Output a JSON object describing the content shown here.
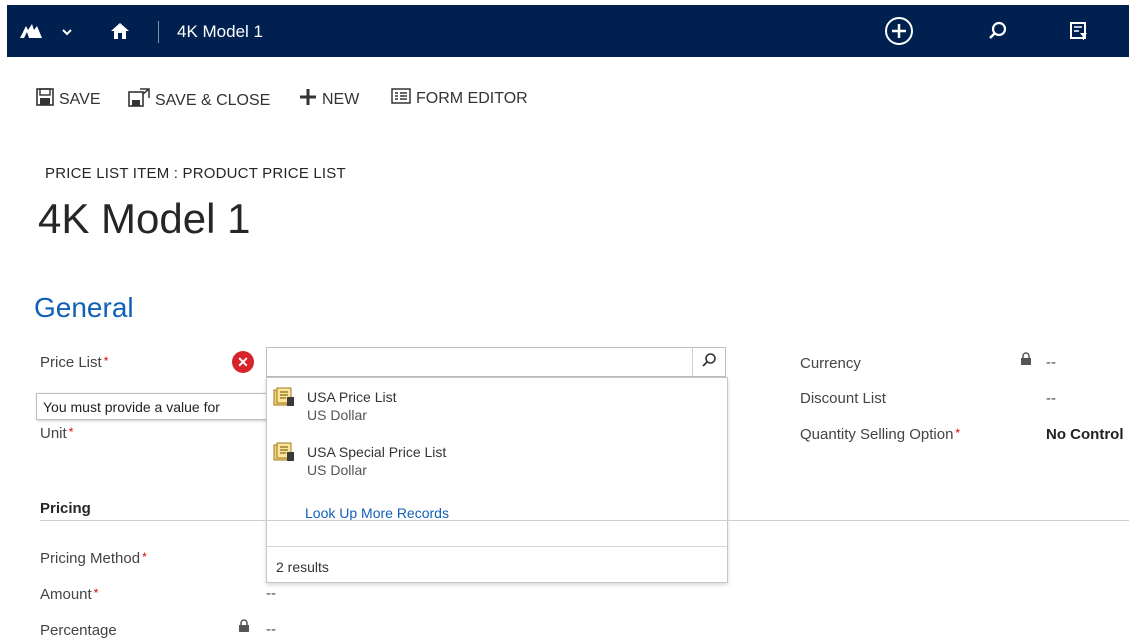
{
  "header": {
    "title": "4K Model 1"
  },
  "toolbar": {
    "save_label": "SAVE",
    "save_close_label": "SAVE & CLOSE",
    "new_label": "NEW",
    "form_editor_label": "FORM EDITOR"
  },
  "record": {
    "breadcrumb": "PRICE LIST ITEM : PRODUCT PRICE LIST",
    "title": "4K Model 1"
  },
  "section": {
    "general_label": "General",
    "pricing_label": "Pricing"
  },
  "fields": {
    "price_list_label": "Price List",
    "unit_label": "Unit",
    "error_tooltip": "You must provide a value for",
    "currency_label": "Currency",
    "currency_value": "--",
    "discount_list_label": "Discount List",
    "discount_list_value": "--",
    "quantity_selling_label": "Quantity Selling Option",
    "quantity_selling_value": "No Control",
    "pricing_method_label": "Pricing Method",
    "amount_label": "Amount",
    "amount_value": "--",
    "percentage_label": "Percentage",
    "percentage_value": "--",
    "required_mark": "*"
  },
  "lookup": {
    "results": [
      {
        "name": "USA Price List",
        "currency": "US Dollar"
      },
      {
        "name": "USA Special Price List",
        "currency": "US Dollar"
      }
    ],
    "more_link": "Look Up More Records",
    "result_count": "2 results"
  },
  "colors": {
    "navbar": "#002050",
    "accent": "#1160b7",
    "error": "#d8232a",
    "required": "#e00000"
  },
  "icons": [
    "dynamics-logo-icon",
    "chevron-down-icon",
    "home-icon",
    "plus-circle-icon",
    "search-icon",
    "filter-icon",
    "save-icon",
    "save-close-icon",
    "plus-icon",
    "form-editor-icon",
    "error-icon",
    "price-list-icon",
    "lock-icon"
  ]
}
